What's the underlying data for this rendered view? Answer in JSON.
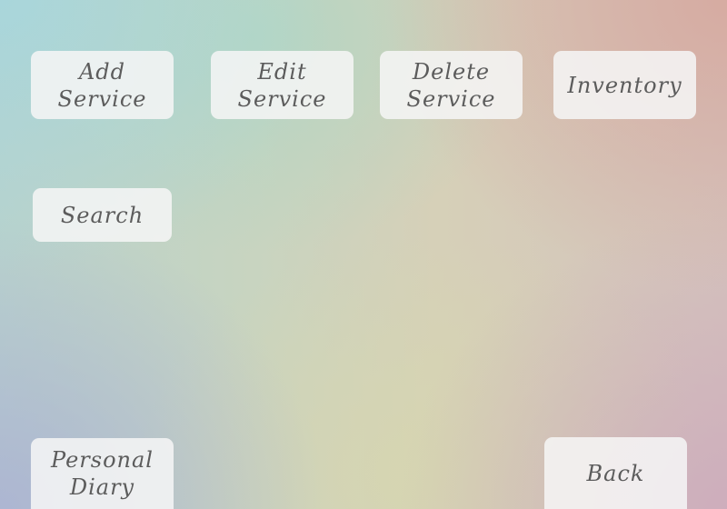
{
  "menu": {
    "add_service": "Add Service",
    "edit_service": "Edit Service",
    "delete_service": "Delete Service",
    "inventory": "Inventory",
    "search": "Search",
    "personal_diary": "Personal Diary",
    "back": "Back"
  },
  "colors": {
    "tile_background": "#f6f6f6",
    "tile_text": "#5c5c5c"
  }
}
